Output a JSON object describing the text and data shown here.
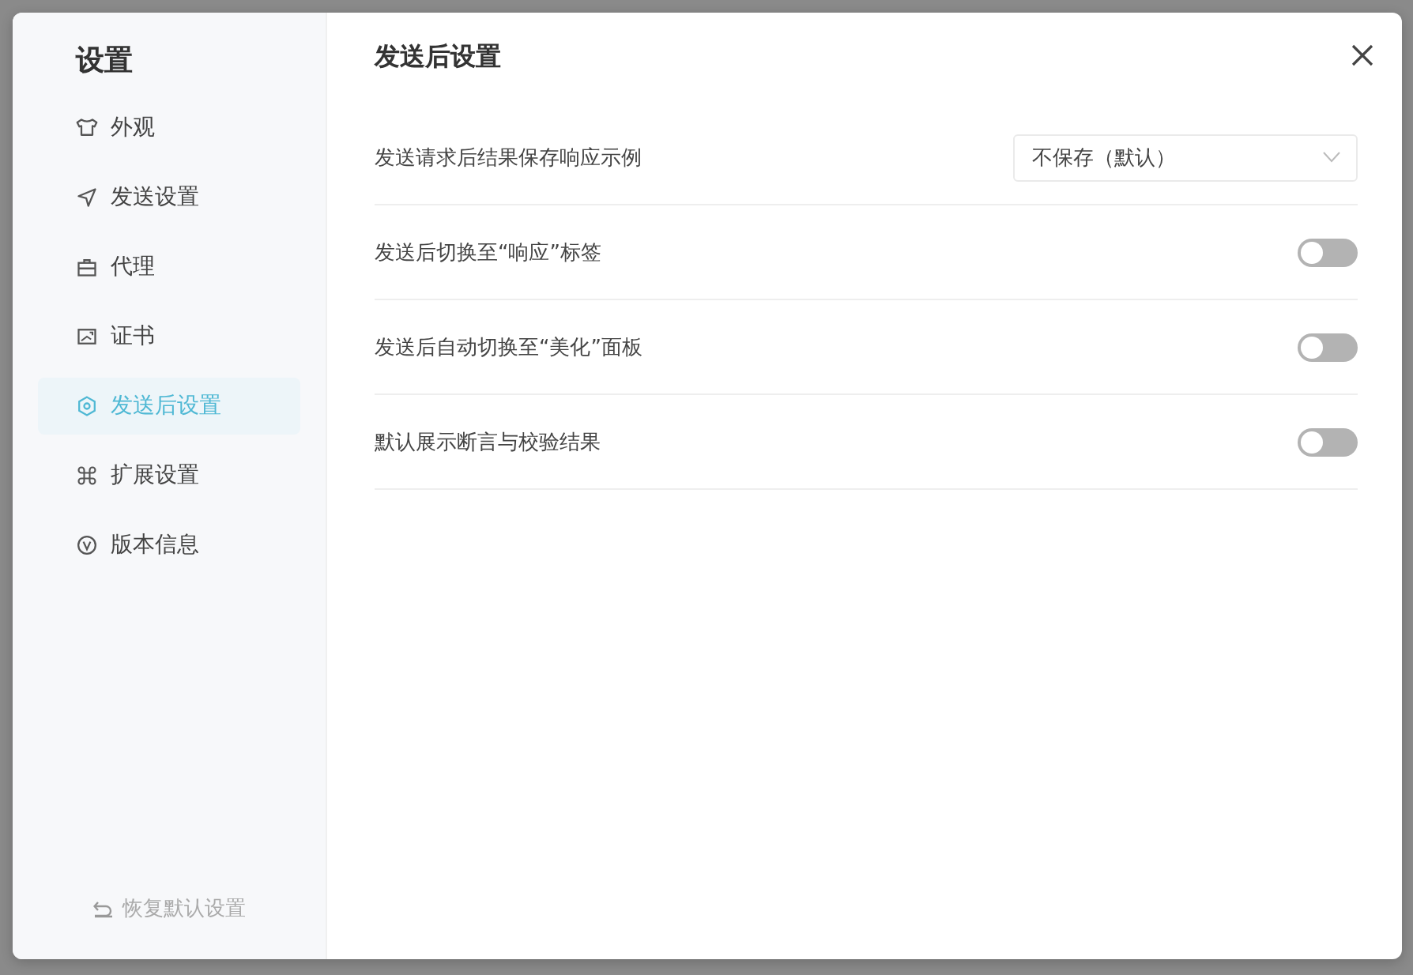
{
  "sidebar": {
    "title": "设置",
    "items": [
      {
        "label": "外观",
        "selected": false
      },
      {
        "label": "发送设置",
        "selected": false
      },
      {
        "label": "代理",
        "selected": false
      },
      {
        "label": "证书",
        "selected": false
      },
      {
        "label": "发送后设置",
        "selected": true
      },
      {
        "label": "扩展设置",
        "selected": false
      },
      {
        "label": "版本信息",
        "selected": false
      }
    ],
    "restore_button": "恢复默认设置"
  },
  "panel": {
    "title": "发送后设置",
    "settings": [
      {
        "kind": "select",
        "label": "发送请求后结果保存响应示例",
        "value": "不保存（默认）"
      },
      {
        "kind": "toggle",
        "label": "发送后切换至“响应”标签",
        "on": false
      },
      {
        "kind": "toggle",
        "label": "发送后自动切换至“美化”面板",
        "on": false
      },
      {
        "kind": "toggle",
        "label": "默认展示断言与校验结果",
        "on": false
      }
    ]
  }
}
